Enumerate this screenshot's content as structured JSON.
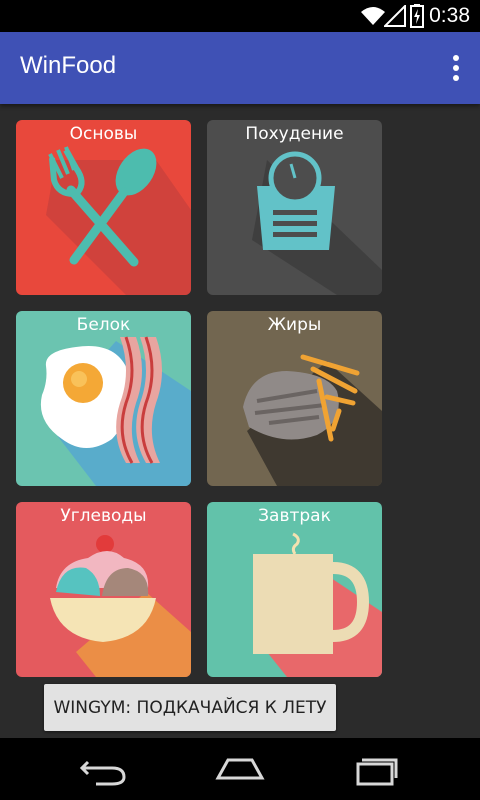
{
  "status": {
    "time": "0:38"
  },
  "app": {
    "title": "WinFood"
  },
  "tiles": [
    {
      "label": "Основы",
      "color": "#e8483c",
      "icon": "fork-spoon-icon"
    },
    {
      "label": "Похудение",
      "color": "#4d4d4d",
      "icon": "scale-icon"
    },
    {
      "label": "Белок",
      "color": "#6bc4b0",
      "icon": "egg-bacon-icon"
    },
    {
      "label": "Жиры",
      "color": "#726650",
      "icon": "steak-fries-icon"
    },
    {
      "label": "Углеводы",
      "color": "#e45a5e",
      "icon": "ice-cream-icon"
    },
    {
      "label": "Завтрак",
      "color": "#62c2aa",
      "icon": "mug-icon"
    }
  ],
  "toast": {
    "text": "WINGYM: ПОДКАЧАЙСЯ К ЛЕТУ"
  },
  "nav": {
    "back": "back-icon",
    "home": "home-icon",
    "recents": "recents-icon"
  }
}
